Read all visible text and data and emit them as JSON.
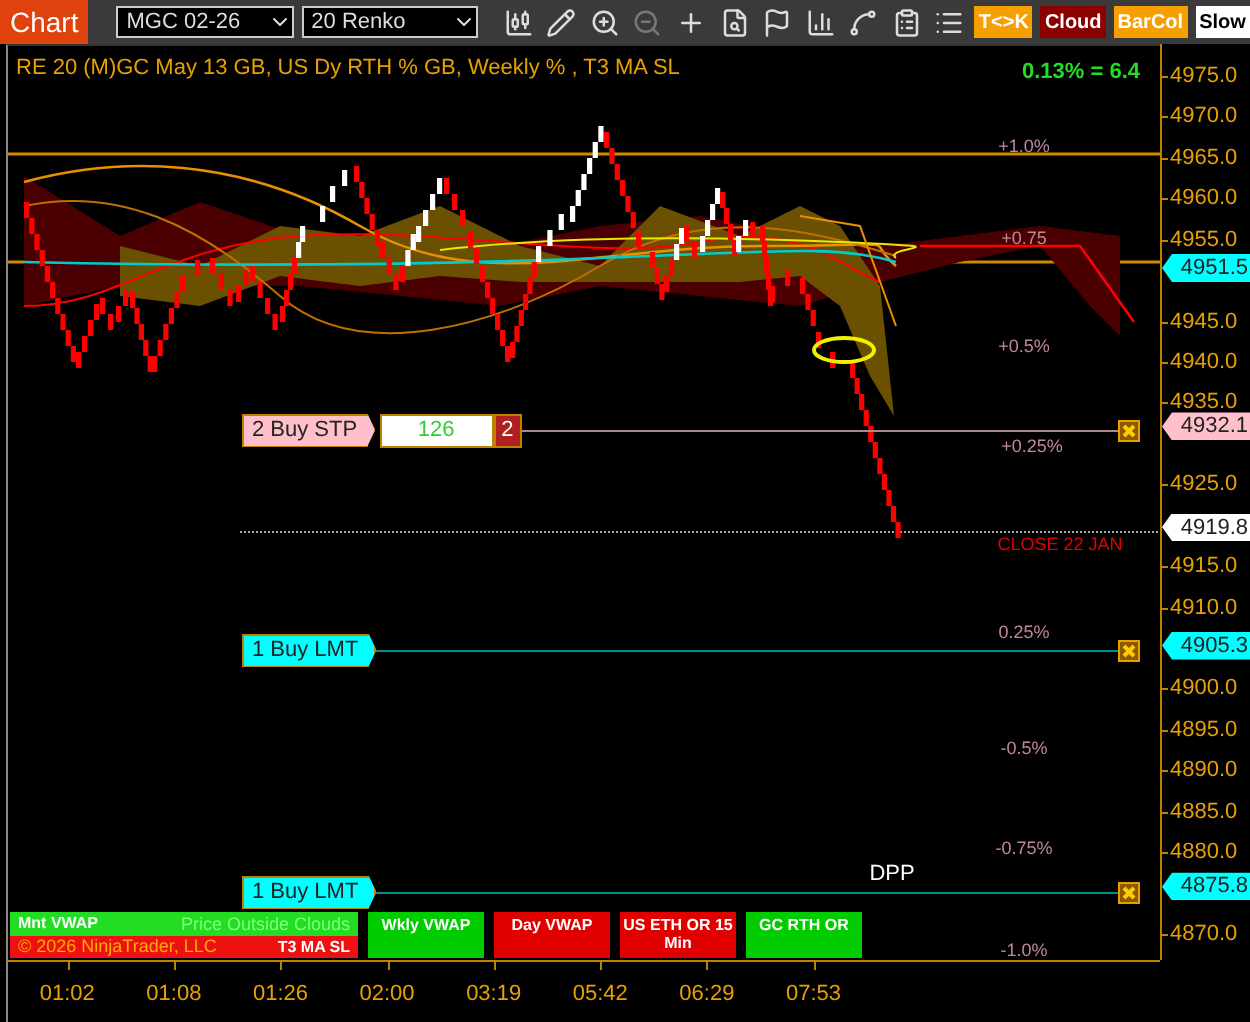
{
  "toolbar": {
    "chart_button": "Chart",
    "instrument": "MGC 02-26",
    "bar_type": "20 Renko",
    "toggles": [
      {
        "label": "T<>K",
        "color": "#f5a000"
      },
      {
        "label": "Cloud",
        "color": "#8b0000"
      },
      {
        "label": "BarCol",
        "color": "#f5a000"
      },
      {
        "label": "Slow",
        "color": "#ffffff"
      }
    ]
  },
  "chart": {
    "header": "RE 20  (M)GC May 13 GB, US Dy RTH % GB, Weekly % , T3 MA SL",
    "change": "0.13% = 6.4",
    "price_axis": [
      "4975.0",
      "4970.0",
      "4965.0",
      "4960.0",
      "4955.0",
      "4945.0",
      "4940.0",
      "4935.0",
      "4925.0",
      "4915.0",
      "4910.0",
      "4900.0",
      "4895.0",
      "4890.0",
      "4885.0",
      "4880.0",
      "4870.0"
    ],
    "price_tags": [
      {
        "text": "4951.5",
        "color": "#00ffff"
      },
      {
        "text": "4932.1",
        "color": "#ffc0cb"
      },
      {
        "text": "4919.8",
        "color": "#ffffff"
      },
      {
        "text": "4905.3",
        "color": "#00ffff"
      },
      {
        "text": "4875.8",
        "color": "#00ffff"
      }
    ],
    "percent_labels": [
      "+1.0%",
      "+0.75",
      "+0.5%",
      "+0.25%",
      "0.25%",
      "-0.5%",
      "-0.75%",
      "-1.0%"
    ],
    "close_label": "CLOSE 22 JAN",
    "pivot_label": "DPP",
    "orders": [
      {
        "label": "2 Buy STP",
        "color": "#ffc0cb",
        "quantity": "126",
        "count": "2"
      },
      {
        "label": "1 Buy LMT",
        "color": "#00ffff"
      },
      {
        "label": "1 Buy LMT",
        "color": "#00ffff"
      }
    ],
    "signal_boxes": [
      {
        "kind": "split",
        "top": {
          "label": "Mnt VWAP",
          "note": "Price Outside Clouds",
          "color": "#22dd22"
        },
        "bottom": {
          "label": "T3 MA SL",
          "note": "© 2026 NinjaTrader, LLC",
          "color": "#ee1111"
        }
      },
      {
        "kind": "single",
        "label": "Wkly VWAP",
        "color": "#00cc00"
      },
      {
        "kind": "single",
        "label": "Day VWAP",
        "color": "#e00000"
      },
      {
        "kind": "single",
        "label": "US ETH OR 15 Min",
        "color": "#e00000"
      },
      {
        "kind": "single",
        "label": "GC RTH OR",
        "color": "#00cc00"
      }
    ],
    "time_axis": [
      "01:02",
      "01:08",
      "01:26",
      "02:00",
      "03:19",
      "05:42",
      "06:29",
      "07:53"
    ]
  }
}
